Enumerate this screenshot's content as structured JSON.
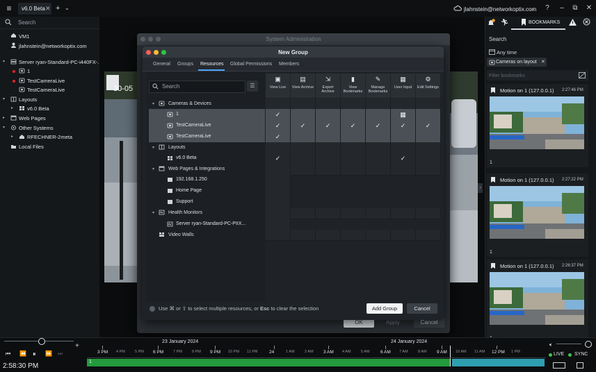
{
  "topbar": {
    "tab_label": "v6.0 Beta",
    "tab_close": "✕",
    "tab_add": "+",
    "tab_dropdown": "⌄",
    "user": "jlahnstein@networkoptix.com",
    "help": "?",
    "minimize": "–",
    "restore": "⧉",
    "close": "✕"
  },
  "left_panel": {
    "search_placeholder": "Search",
    "tree": [
      {
        "label": "VM1",
        "icon": "home-icon"
      },
      {
        "label": "jlahnstein@networkoptix.com",
        "icon": "user-icon"
      },
      {
        "label": "Server ryan-Standard-PC-i440FX-...",
        "icon": "server-icon"
      },
      {
        "label": "1",
        "icon": "camera-icon"
      },
      {
        "label": "TestCameraLive",
        "icon": "camera-icon"
      },
      {
        "label": "TestCameraLive",
        "icon": "camera-icon"
      },
      {
        "label": "Layouts",
        "icon": "layouts-icon"
      },
      {
        "label": "v6.0 Beta",
        "icon": "layout-icon"
      },
      {
        "label": "Web Pages",
        "icon": "web-icon"
      },
      {
        "label": "Other Systems",
        "icon": "systems-icon"
      },
      {
        "label": "RFECHNER-2meta",
        "icon": "home-icon"
      },
      {
        "label": "Local Files",
        "icon": "folder-icon"
      }
    ]
  },
  "center": {
    "timestamp": "30-05"
  },
  "system_admin": {
    "title": "System Administration",
    "ok": "OK",
    "apply": "Apply",
    "cancel": "Cancel"
  },
  "new_group": {
    "title": "New Group",
    "tabs": [
      "General",
      "Groups",
      "Resources",
      "Global Permissions",
      "Members"
    ],
    "active_tab": "Resources",
    "search_placeholder": "Search",
    "columns": [
      "View Live",
      "View Archive",
      "Export Archive",
      "View Bookmarks",
      "Manage Bookmarks",
      "User Input",
      "Edit Settings"
    ],
    "resources": [
      {
        "label": "Cameras & Devices",
        "type": "group"
      },
      {
        "label": "1",
        "type": "item"
      },
      {
        "label": "TestCameraLive",
        "type": "item"
      },
      {
        "label": "TestCameraLive",
        "type": "item"
      },
      {
        "label": "Layouts",
        "type": "group"
      },
      {
        "label": "v6.0 Beta",
        "type": "item"
      },
      {
        "label": "Web Pages & Integrations",
        "type": "group"
      },
      {
        "label": "192.168.1.250",
        "type": "item"
      },
      {
        "label": "Home Page",
        "type": "item"
      },
      {
        "label": "Support",
        "type": "item"
      },
      {
        "label": "Health Monitors",
        "type": "group"
      },
      {
        "label": "Server ryan-Standard-PC-PIIX...",
        "type": "item"
      },
      {
        "label": "Video Walls",
        "type": "group"
      }
    ],
    "hint_prefix": "Use",
    "hint_cmd": "⌘",
    "hint_or": "or",
    "hint_shift": "⇧",
    "hint_mid": "to select multiple resources, or",
    "hint_esc": "Esc",
    "hint_suffix": "to clear the selection",
    "add_group": "Add Group",
    "cancel": "Cancel"
  },
  "right_panel": {
    "bookmarks_tab": "BOOKMARKS",
    "search": "Search",
    "any_time": "Any time",
    "filter_chip": "Cameras on layout",
    "bookmark_search_placeholder": "Filter bookmarks",
    "cards": [
      {
        "title": "Motion on 1 (127.0.0.1)",
        "time": "2:27:46 PM",
        "num": "1"
      },
      {
        "title": "Motion on 1 (127.0.0.1)",
        "time": "2:27:22 PM",
        "num": "1"
      },
      {
        "title": "Motion on 1 (127.0.0.1)",
        "time": "2:26:37 PM",
        "num": "1"
      }
    ]
  },
  "timeline": {
    "date1": "23 January 2024",
    "date2": "24 January 2024",
    "time_readout": "2:58:30 PM",
    "live": "LIVE",
    "sync": "SYNC",
    "channel": "1",
    "hours_major": [
      "3 PM",
      "6 PM",
      "9 PM",
      "24",
      "3 AM",
      "6 AM",
      "9 AM",
      "12 PM"
    ],
    "hours_minor": [
      "4 PM",
      "5 PM",
      "7 PM",
      "8 PM",
      "10 PM",
      "11 PM",
      "1 AM",
      "2 AM",
      "4 AM",
      "5 AM",
      "7 AM",
      "8 AM",
      "10 AM",
      "11 AM",
      "1 PM"
    ]
  }
}
